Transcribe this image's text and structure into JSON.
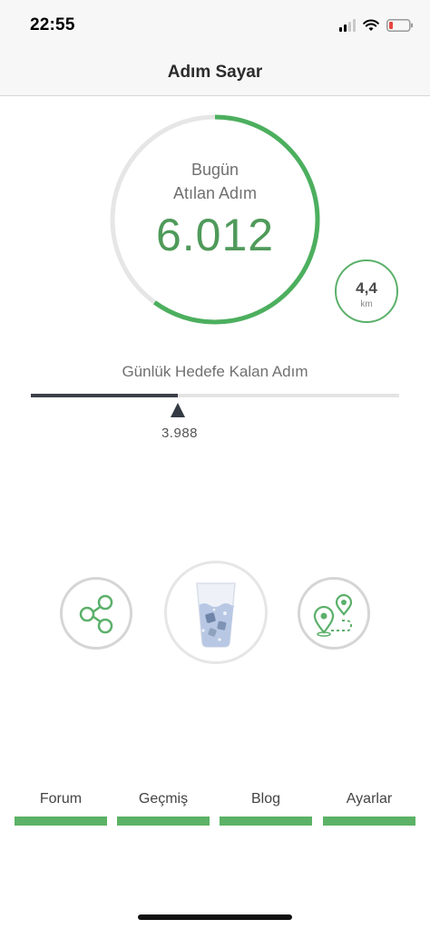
{
  "status_bar": {
    "time": "22:55",
    "signal_icon": "cellular-signal-icon",
    "wifi_icon": "wifi-icon",
    "battery_icon": "battery-low-icon",
    "battery_color": "#e5483f"
  },
  "nav": {
    "title": "Adım Sayar"
  },
  "today": {
    "label_line1": "Bugün",
    "label_line2": "Atılan Adım",
    "steps": "6.012",
    "progress_fraction": 0.6
  },
  "distance": {
    "value": "4,4",
    "unit": "km"
  },
  "goal": {
    "label": "Günlük Hedefe Kalan Adım",
    "remaining": "3.988",
    "progress_fraction": 0.4
  },
  "actions": {
    "share_icon": "share-icon",
    "water_icon": "water-glass-icon",
    "route_icon": "route-map-icon"
  },
  "tabs": [
    {
      "label": "Forum"
    },
    {
      "label": "Geçmiş"
    },
    {
      "label": "Blog"
    },
    {
      "label": "Ayarlar"
    }
  ],
  "colors": {
    "accent": "#4caf5e",
    "ring_track": "#e6e6e6",
    "goal_fill": "#3b4049"
  }
}
